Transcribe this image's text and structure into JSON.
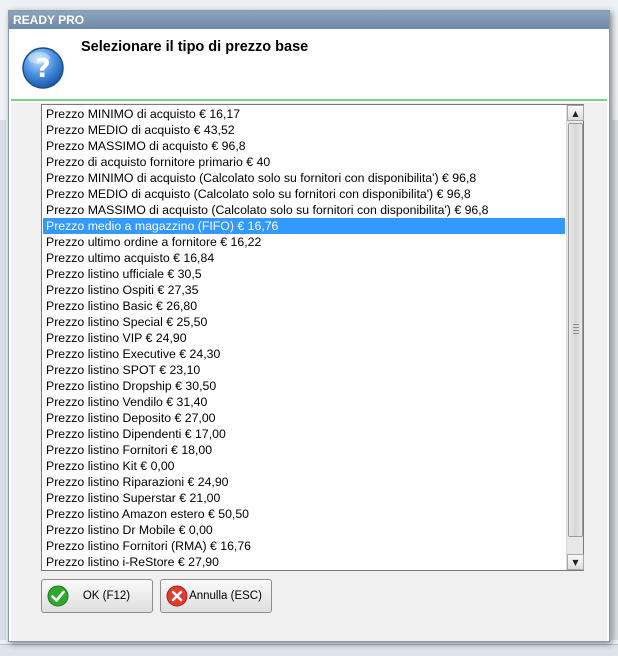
{
  "window": {
    "title": "READY PRO"
  },
  "header": {
    "title": "Selezionare il tipo di prezzo base"
  },
  "list": {
    "selected_index": 7,
    "items": [
      "Prezzo MINIMO di acquisto € 16,17",
      "Prezzo MEDIO di acquisto € 43,52",
      "Prezzo MASSIMO di acquisto € 96,8",
      "Prezzo di acquisto fornitore primario € 40",
      "Prezzo MINIMO di acquisto (Calcolato solo su fornitori con disponibilita') € 96,8",
      "Prezzo MEDIO di acquisto (Calcolato solo su fornitori con disponibilita') € 96,8",
      "Prezzo MASSIMO di acquisto (Calcolato solo su fornitori con disponibilita') € 96,8",
      "Prezzo medio a magazzino (FIFO) € 16,76",
      "Prezzo ultimo ordine a fornitore € 16,22",
      "Prezzo ultimo acquisto € 16,84",
      "Prezzo listino ufficiale € 30,5",
      "Prezzo listino Ospiti € 27,35",
      "Prezzo listino Basic € 26,80",
      "Prezzo listino Special € 25,50",
      "Prezzo listino VIP € 24,90",
      "Prezzo listino Executive € 24,30",
      "Prezzo listino SPOT € 23,10",
      "Prezzo listino Dropship € 30,50",
      "Prezzo listino Vendilo € 31,40",
      "Prezzo listino Deposito € 27,00",
      "Prezzo listino Dipendenti € 17,00",
      "Prezzo listino Fornitori € 18,00",
      "Prezzo listino Kit € 0,00",
      "Prezzo listino Riparazioni € 24,90",
      "Prezzo listino Superstar € 21,00",
      "Prezzo listino Amazon estero € 50,50",
      "Prezzo listino Dr Mobile € 0,00",
      "Prezzo listino Fornitori (RMA) € 16,76",
      "Prezzo listino i-ReStore € 27,90"
    ]
  },
  "buttons": {
    "ok_label": "OK (F12)",
    "cancel_label": "Annulla (ESC)"
  },
  "icons": {
    "header": "question-icon",
    "ok": "check-icon",
    "cancel": "cancel-icon",
    "scroll_up": "arrow-up-icon",
    "scroll_down": "arrow-down-icon"
  },
  "colors": {
    "selection": "#3399ff",
    "header_border": "#7fd27f",
    "title_bar": "#7a93b0"
  }
}
